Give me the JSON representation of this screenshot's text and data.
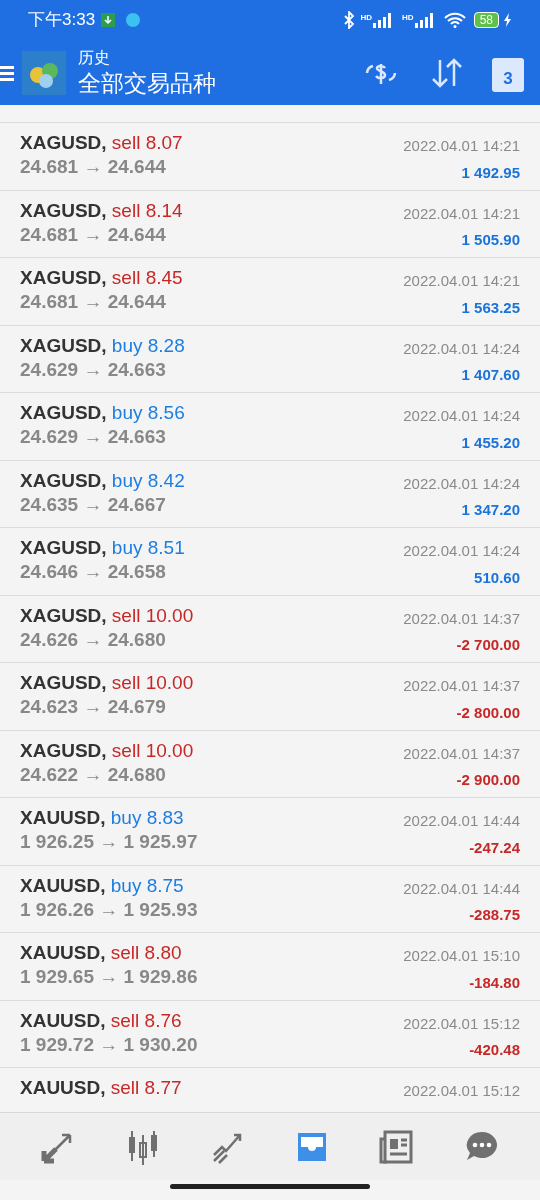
{
  "status_bar": {
    "time": "下午3:33",
    "signal_labels": [
      "HD",
      "HD"
    ],
    "battery": "58"
  },
  "header": {
    "title": "历史",
    "subtitle": "全部交易品种",
    "calendar_day": "3"
  },
  "trades": [
    {
      "symbol": "XAGUSD,",
      "kind": "sell",
      "order": "sell 8.07",
      "prices": "24.681 → 24.644",
      "time": "2022.04.01 14:21",
      "profit": "1 492.95",
      "loss": false
    },
    {
      "symbol": "XAGUSD,",
      "kind": "sell",
      "order": "sell 8.14",
      "prices": "24.681 → 24.644",
      "time": "2022.04.01 14:21",
      "profit": "1 505.90",
      "loss": false
    },
    {
      "symbol": "XAGUSD,",
      "kind": "sell",
      "order": "sell 8.45",
      "prices": "24.681 → 24.644",
      "time": "2022.04.01 14:21",
      "profit": "1 563.25",
      "loss": false
    },
    {
      "symbol": "XAGUSD,",
      "kind": "buy",
      "order": "buy 8.28",
      "prices": "24.629 → 24.663",
      "time": "2022.04.01 14:24",
      "profit": "1 407.60",
      "loss": false
    },
    {
      "symbol": "XAGUSD,",
      "kind": "buy",
      "order": "buy 8.56",
      "prices": "24.629 → 24.663",
      "time": "2022.04.01 14:24",
      "profit": "1 455.20",
      "loss": false
    },
    {
      "symbol": "XAGUSD,",
      "kind": "buy",
      "order": "buy 8.42",
      "prices": "24.635 → 24.667",
      "time": "2022.04.01 14:24",
      "profit": "1 347.20",
      "loss": false
    },
    {
      "symbol": "XAGUSD,",
      "kind": "buy",
      "order": "buy 8.51",
      "prices": "24.646 → 24.658",
      "time": "2022.04.01 14:24",
      "profit": "510.60",
      "loss": false
    },
    {
      "symbol": "XAGUSD,",
      "kind": "sell",
      "order": "sell 10.00",
      "prices": "24.626 → 24.680",
      "time": "2022.04.01 14:37",
      "profit": "-2 700.00",
      "loss": true
    },
    {
      "symbol": "XAGUSD,",
      "kind": "sell",
      "order": "sell 10.00",
      "prices": "24.623 → 24.679",
      "time": "2022.04.01 14:37",
      "profit": "-2 800.00",
      "loss": true
    },
    {
      "symbol": "XAGUSD,",
      "kind": "sell",
      "order": "sell 10.00",
      "prices": "24.622 → 24.680",
      "time": "2022.04.01 14:37",
      "profit": "-2 900.00",
      "loss": true
    },
    {
      "symbol": "XAUUSD,",
      "kind": "buy",
      "order": "buy 8.83",
      "prices": "1 926.25 → 1 925.97",
      "time": "2022.04.01 14:44",
      "profit": "-247.24",
      "loss": true
    },
    {
      "symbol": "XAUUSD,",
      "kind": "buy",
      "order": "buy 8.75",
      "prices": "1 926.26 → 1 925.93",
      "time": "2022.04.01 14:44",
      "profit": "-288.75",
      "loss": true
    },
    {
      "symbol": "XAUUSD,",
      "kind": "sell",
      "order": "sell 8.80",
      "prices": "1 929.65 → 1 929.86",
      "time": "2022.04.01 15:10",
      "profit": "-184.80",
      "loss": true
    },
    {
      "symbol": "XAUUSD,",
      "kind": "sell",
      "order": "sell 8.76",
      "prices": "1 929.72 → 1 930.20",
      "time": "2022.04.01 15:12",
      "profit": "-420.48",
      "loss": true
    },
    {
      "symbol": "XAUUSD,",
      "kind": "sell",
      "order": "sell 8.77",
      "time": "2022.04.01 15:12"
    }
  ],
  "bottom_nav": [
    {
      "selected": false
    },
    {
      "selected": false
    },
    {
      "selected": false
    },
    {
      "selected": true
    },
    {
      "selected": false
    },
    {
      "selected": false
    }
  ]
}
